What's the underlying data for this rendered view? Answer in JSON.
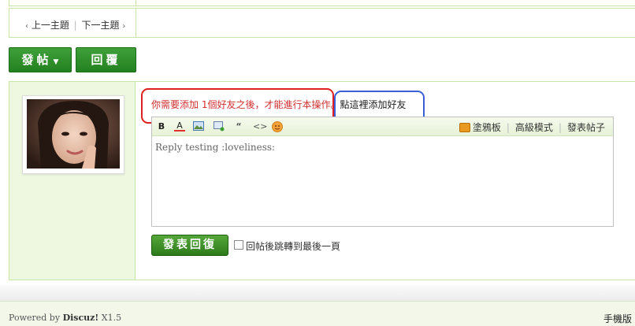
{
  "thread_nav": {
    "prev": "上一主題",
    "next": "下一主題"
  },
  "actions": {
    "post": "發帖",
    "reply": "回覆"
  },
  "notice": {
    "requirement": "你需要添加 1個好友之後，才能進行本操作",
    "separator": "。",
    "link": "點這裡添加好友"
  },
  "editor": {
    "toolbar_right": [
      "塗鴉板",
      "高級模式",
      "發表帖子"
    ],
    "content": "Reply testing :loveliness:"
  },
  "submit": {
    "label": "發表回復",
    "checkbox_label": "回帖後跳轉到最後一頁"
  },
  "footer": {
    "powered_by": "Powered by",
    "brand": "Discuz!",
    "version": "X1.5",
    "mobile": "手機版"
  },
  "colors": {
    "accent_green": "#2d7a1b",
    "border_green": "#c8e6a8",
    "notice_red": "#d03030",
    "ring_red": "#e02020",
    "ring_blue": "#3a5fd8"
  }
}
